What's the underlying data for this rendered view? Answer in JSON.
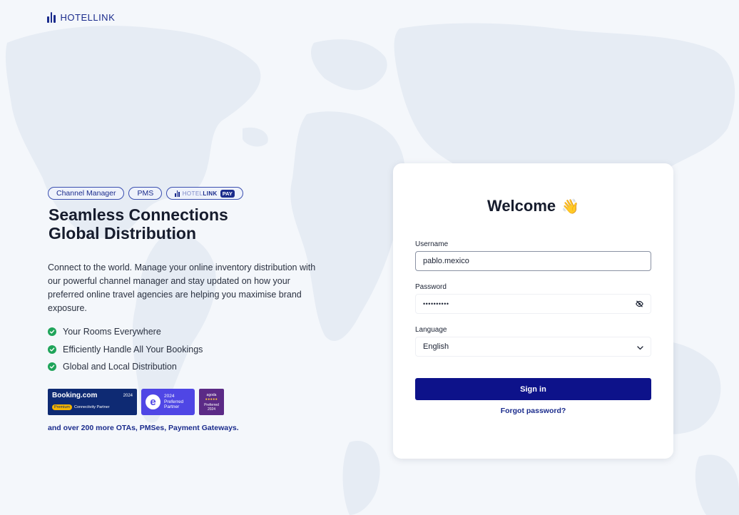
{
  "brand": {
    "name": "HOTELLINK"
  },
  "pills": [
    {
      "label": "Channel Manager"
    },
    {
      "label": "PMS"
    },
    {
      "label_light": "HOTEL",
      "label_strong": "LINK",
      "tag": "PAY"
    }
  ],
  "headline": {
    "line1": "Seamless Connections",
    "line2": "Global Distribution"
  },
  "description": "Connect to the world. Manage your online inventory distribution with our powerful channel manager and stay updated on how your preferred online travel agencies are helping you maximise brand exposure.",
  "features": [
    {
      "label": "Your Rooms Everywhere"
    },
    {
      "label": "Efficiently Handle All Your Bookings"
    },
    {
      "label": "Global and Local Distribution"
    }
  ],
  "badges": {
    "booking": {
      "name": "Booking.com",
      "year": "2024",
      "tier": "Premium",
      "subtitle": "Connectivity Partner"
    },
    "expedia": {
      "letter": "e",
      "year": "2024",
      "line1": "Preferred",
      "line2": "Partner"
    },
    "agoda": {
      "name": "agoda",
      "dots": "●●●●●",
      "line1": "Preferred",
      "line2": "2024"
    }
  },
  "more_text": "and over 200 more OTAs, PMSes, Payment Gateways.",
  "login": {
    "title": "Welcome",
    "emoji": "👋",
    "username_label": "Username",
    "username_value": "pablo.mexico",
    "password_label": "Password",
    "password_value": "••••••••••",
    "language_label": "Language",
    "language_value": "English",
    "signin_label": "Sign in",
    "forgot_label": "Forgot password?"
  },
  "colors": {
    "brand": "#1a2b8c",
    "button": "#0d128a",
    "check": "#1fa45a",
    "background": "#f4f7fb"
  },
  "icons": [
    "hotellink-logo-icon",
    "check-circle-icon",
    "eye-off-icon",
    "chevron-down-icon",
    "world-map-icon"
  ]
}
